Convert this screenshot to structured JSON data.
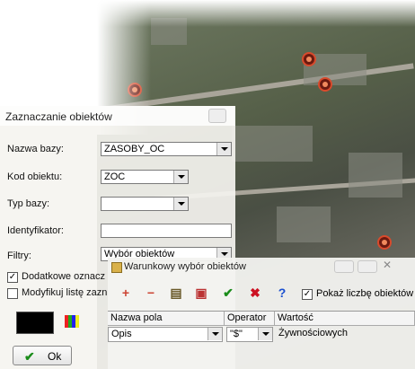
{
  "map": {
    "label": "aerial map background"
  },
  "dialog": {
    "title": "Zaznaczanie obiektów",
    "nazwa_bazy": {
      "label": "Nazwa bazy:",
      "value": "ZASOBY_OC"
    },
    "kod_obiektu": {
      "label": "Kod obiektu:",
      "value": "ZOC"
    },
    "typ_bazy": {
      "label": "Typ bazy:",
      "value": ""
    },
    "identyfikator": {
      "label": "Identyfikator:",
      "value": ""
    },
    "filtry": {
      "label": "Filtry:",
      "value": "Wybór obiektów"
    },
    "dodatkowe": {
      "label": "Dodatkowe oznacz",
      "checked": true
    },
    "modyfikuj": {
      "label": "Modyfikuj listę zazn",
      "checked": false
    },
    "ok_label": "Ok",
    "color": "#000000"
  },
  "conditions": {
    "title": "Warunkowy wybór obiektów",
    "show_count_label": "Pokaż liczbę obiektów",
    "show_count_checked": true,
    "columns": [
      "Nazwa pola",
      "Operator",
      "Wartość"
    ],
    "row": {
      "field": "Opis",
      "operator": "\"$\"",
      "value": "Żywnościowych"
    }
  }
}
